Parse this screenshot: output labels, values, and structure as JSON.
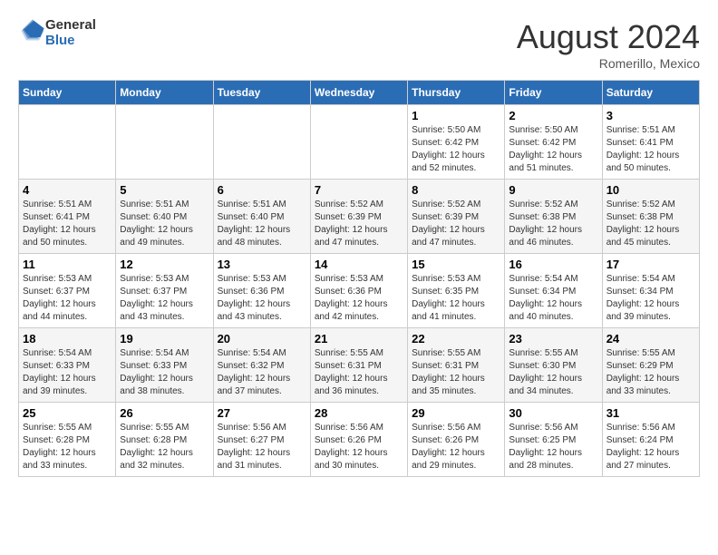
{
  "header": {
    "logo_general": "General",
    "logo_blue": "Blue",
    "month_year": "August 2024",
    "location": "Romerillo, Mexico"
  },
  "calendar": {
    "days_of_week": [
      "Sunday",
      "Monday",
      "Tuesday",
      "Wednesday",
      "Thursday",
      "Friday",
      "Saturday"
    ],
    "weeks": [
      [
        {
          "day": "",
          "info": ""
        },
        {
          "day": "",
          "info": ""
        },
        {
          "day": "",
          "info": ""
        },
        {
          "day": "",
          "info": ""
        },
        {
          "day": "1",
          "info": "Sunrise: 5:50 AM\nSunset: 6:42 PM\nDaylight: 12 hours\nand 52 minutes."
        },
        {
          "day": "2",
          "info": "Sunrise: 5:50 AM\nSunset: 6:42 PM\nDaylight: 12 hours\nand 51 minutes."
        },
        {
          "day": "3",
          "info": "Sunrise: 5:51 AM\nSunset: 6:41 PM\nDaylight: 12 hours\nand 50 minutes."
        }
      ],
      [
        {
          "day": "4",
          "info": "Sunrise: 5:51 AM\nSunset: 6:41 PM\nDaylight: 12 hours\nand 50 minutes."
        },
        {
          "day": "5",
          "info": "Sunrise: 5:51 AM\nSunset: 6:40 PM\nDaylight: 12 hours\nand 49 minutes."
        },
        {
          "day": "6",
          "info": "Sunrise: 5:51 AM\nSunset: 6:40 PM\nDaylight: 12 hours\nand 48 minutes."
        },
        {
          "day": "7",
          "info": "Sunrise: 5:52 AM\nSunset: 6:39 PM\nDaylight: 12 hours\nand 47 minutes."
        },
        {
          "day": "8",
          "info": "Sunrise: 5:52 AM\nSunset: 6:39 PM\nDaylight: 12 hours\nand 47 minutes."
        },
        {
          "day": "9",
          "info": "Sunrise: 5:52 AM\nSunset: 6:38 PM\nDaylight: 12 hours\nand 46 minutes."
        },
        {
          "day": "10",
          "info": "Sunrise: 5:52 AM\nSunset: 6:38 PM\nDaylight: 12 hours\nand 45 minutes."
        }
      ],
      [
        {
          "day": "11",
          "info": "Sunrise: 5:53 AM\nSunset: 6:37 PM\nDaylight: 12 hours\nand 44 minutes."
        },
        {
          "day": "12",
          "info": "Sunrise: 5:53 AM\nSunset: 6:37 PM\nDaylight: 12 hours\nand 43 minutes."
        },
        {
          "day": "13",
          "info": "Sunrise: 5:53 AM\nSunset: 6:36 PM\nDaylight: 12 hours\nand 43 minutes."
        },
        {
          "day": "14",
          "info": "Sunrise: 5:53 AM\nSunset: 6:36 PM\nDaylight: 12 hours\nand 42 minutes."
        },
        {
          "day": "15",
          "info": "Sunrise: 5:53 AM\nSunset: 6:35 PM\nDaylight: 12 hours\nand 41 minutes."
        },
        {
          "day": "16",
          "info": "Sunrise: 5:54 AM\nSunset: 6:34 PM\nDaylight: 12 hours\nand 40 minutes."
        },
        {
          "day": "17",
          "info": "Sunrise: 5:54 AM\nSunset: 6:34 PM\nDaylight: 12 hours\nand 39 minutes."
        }
      ],
      [
        {
          "day": "18",
          "info": "Sunrise: 5:54 AM\nSunset: 6:33 PM\nDaylight: 12 hours\nand 39 minutes."
        },
        {
          "day": "19",
          "info": "Sunrise: 5:54 AM\nSunset: 6:33 PM\nDaylight: 12 hours\nand 38 minutes."
        },
        {
          "day": "20",
          "info": "Sunrise: 5:54 AM\nSunset: 6:32 PM\nDaylight: 12 hours\nand 37 minutes."
        },
        {
          "day": "21",
          "info": "Sunrise: 5:55 AM\nSunset: 6:31 PM\nDaylight: 12 hours\nand 36 minutes."
        },
        {
          "day": "22",
          "info": "Sunrise: 5:55 AM\nSunset: 6:31 PM\nDaylight: 12 hours\nand 35 minutes."
        },
        {
          "day": "23",
          "info": "Sunrise: 5:55 AM\nSunset: 6:30 PM\nDaylight: 12 hours\nand 34 minutes."
        },
        {
          "day": "24",
          "info": "Sunrise: 5:55 AM\nSunset: 6:29 PM\nDaylight: 12 hours\nand 33 minutes."
        }
      ],
      [
        {
          "day": "25",
          "info": "Sunrise: 5:55 AM\nSunset: 6:28 PM\nDaylight: 12 hours\nand 33 minutes."
        },
        {
          "day": "26",
          "info": "Sunrise: 5:55 AM\nSunset: 6:28 PM\nDaylight: 12 hours\nand 32 minutes."
        },
        {
          "day": "27",
          "info": "Sunrise: 5:56 AM\nSunset: 6:27 PM\nDaylight: 12 hours\nand 31 minutes."
        },
        {
          "day": "28",
          "info": "Sunrise: 5:56 AM\nSunset: 6:26 PM\nDaylight: 12 hours\nand 30 minutes."
        },
        {
          "day": "29",
          "info": "Sunrise: 5:56 AM\nSunset: 6:26 PM\nDaylight: 12 hours\nand 29 minutes."
        },
        {
          "day": "30",
          "info": "Sunrise: 5:56 AM\nSunset: 6:25 PM\nDaylight: 12 hours\nand 28 minutes."
        },
        {
          "day": "31",
          "info": "Sunrise: 5:56 AM\nSunset: 6:24 PM\nDaylight: 12 hours\nand 27 minutes."
        }
      ]
    ]
  }
}
